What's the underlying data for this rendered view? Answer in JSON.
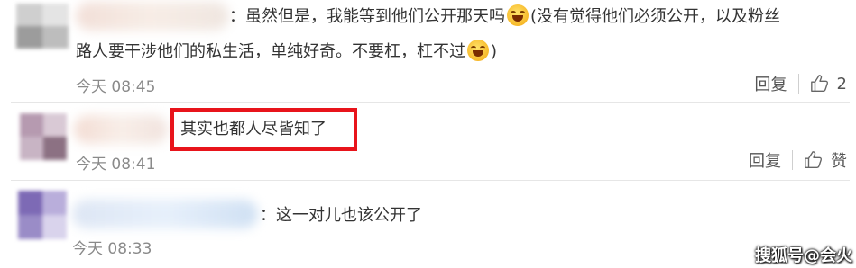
{
  "comments": [
    {
      "text_line1_a": "：虽然但是，我能等到他们公开那天吗",
      "text_line1_b": "(没有觉得他们必须公开，以及粉丝",
      "text_line2_a": "路人要干涉他们的私生活，单纯好奇。不要杠，杠不过",
      "text_line2_b": ")",
      "time": "今天 08:45",
      "reply_label": "回复",
      "like_count": "2"
    },
    {
      "text": "其实也都人尽皆知了",
      "time": "今天 08:41",
      "reply_label": "回复",
      "like_count": "赞"
    },
    {
      "text": "：这一对儿也该公开了",
      "time": "今天 08:33"
    }
  ],
  "icons": {
    "like": "thumbs-up-icon",
    "emoji": "grinning-face-icon"
  },
  "colors": {
    "highlight": "#e8141b",
    "time": "#8a8a8a"
  },
  "watermark": "搜狐号@会火"
}
